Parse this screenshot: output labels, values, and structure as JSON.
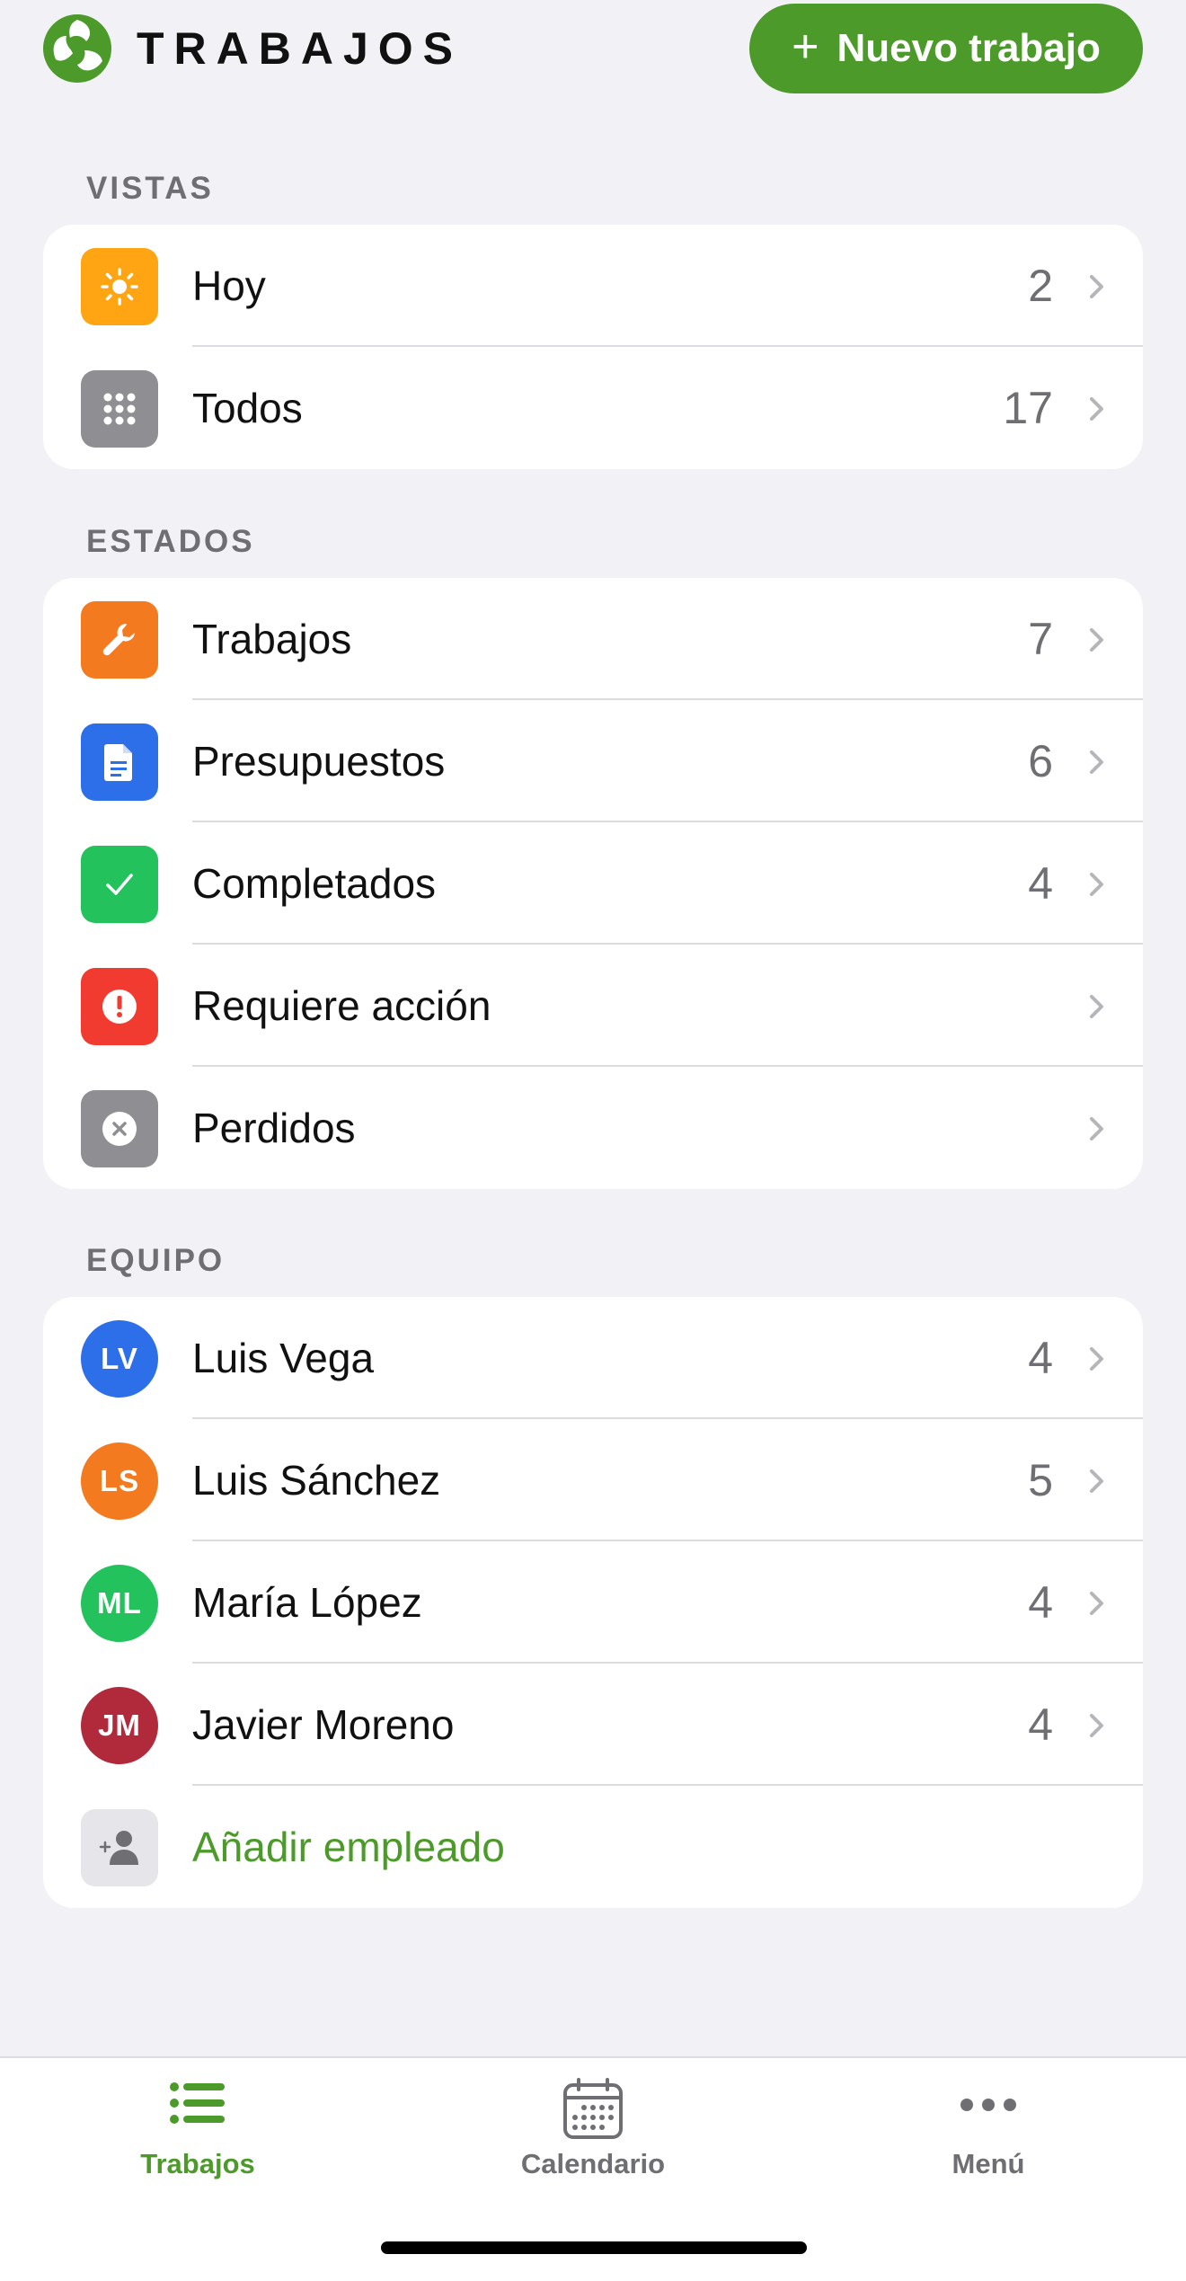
{
  "header": {
    "title": "TRABAJOS",
    "new_button_icon": "plus-icon",
    "new_button_label": "Nuevo trabajo"
  },
  "vistas": {
    "label": "VISTAS",
    "items": [
      {
        "label": "Hoy",
        "count": "2",
        "icon": "sun-icon",
        "color": "#ffa412"
      },
      {
        "label": "Todos",
        "count": "17",
        "icon": "grid-icon",
        "color": "#8e8e93"
      }
    ]
  },
  "estados": {
    "label": "ESTADOS",
    "items": [
      {
        "label": "Trabajos",
        "count": "7",
        "icon": "wrench-icon",
        "color": "#f47a1f"
      },
      {
        "label": "Presupuestos",
        "count": "6",
        "icon": "document-icon",
        "color": "#2d6fe8"
      },
      {
        "label": "Completados",
        "count": "4",
        "icon": "checkmark-icon",
        "color": "#24c25d"
      },
      {
        "label": "Requiere acción",
        "count": "",
        "icon": "alert-icon",
        "color": "#f23b30"
      },
      {
        "label": "Perdidos",
        "count": "",
        "icon": "x-circle-icon",
        "color": "#8e8e93"
      }
    ]
  },
  "equipo": {
    "label": "EQUIPO",
    "members": [
      {
        "initials": "LV",
        "name": "Luis Vega",
        "count": "4",
        "color": "#2d6fe8"
      },
      {
        "initials": "LS",
        "name": "Luis Sánchez",
        "count": "5",
        "color": "#f47a1f"
      },
      {
        "initials": "ML",
        "name": "María López",
        "count": "4",
        "color": "#24c25d"
      },
      {
        "initials": "JM",
        "name": "Javier Moreno",
        "count": "4",
        "color": "#b12a3c"
      }
    ],
    "add_label": "Añadir empleado",
    "add_icon": "add-person-icon"
  },
  "tabbar": {
    "tabs": [
      {
        "label": "Trabajos",
        "icon": "list-icon",
        "active": true
      },
      {
        "label": "Calendario",
        "icon": "calendar-icon",
        "active": false
      },
      {
        "label": "Menú",
        "icon": "more-icon",
        "active": false
      }
    ]
  },
  "colors": {
    "accent": "#4c9a2a",
    "background": "#f1f1f6"
  }
}
